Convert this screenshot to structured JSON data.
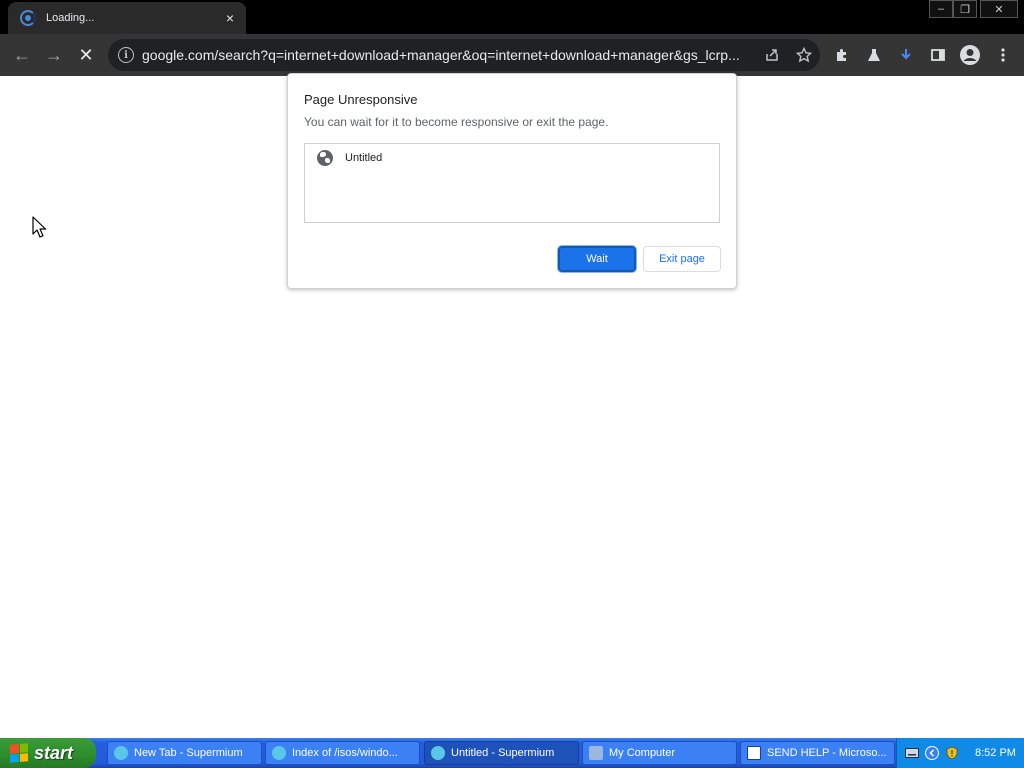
{
  "browser": {
    "tab": {
      "title": "Loading...",
      "close_glyph": "×"
    },
    "window_controls": {
      "minimize": "–",
      "restore": "❐",
      "close": "✕"
    },
    "toolbar": {
      "back_glyph": "←",
      "forward_glyph": "→",
      "stop_glyph": "✕",
      "url": "google.com/search?q=internet+download+manager&oq=internet+download+manager&gs_lcrp..."
    }
  },
  "dialog": {
    "title": "Page Unresponsive",
    "body": "You can wait for it to become responsive or exit the page.",
    "pages": [
      {
        "label": "Untitled"
      }
    ],
    "wait_label": "Wait",
    "exit_label": "Exit page"
  },
  "taskbar": {
    "start_label": "start",
    "items": [
      {
        "label": "New Tab - Supermium",
        "icon": "supermium-icon"
      },
      {
        "label": "Index of /isos/windo...",
        "icon": "supermium-icon"
      },
      {
        "label": "Untitled - Supermium",
        "icon": "supermium-icon",
        "active": true
      },
      {
        "label": "My Computer",
        "icon": "computer-icon"
      },
      {
        "label": "SEND HELP - Microso...",
        "icon": "word-icon"
      }
    ],
    "clock": "8:52 PM"
  },
  "colors": {
    "accent": "#1a73e8",
    "taskbar": "#245edc",
    "start_green": "#2f8f2f"
  }
}
